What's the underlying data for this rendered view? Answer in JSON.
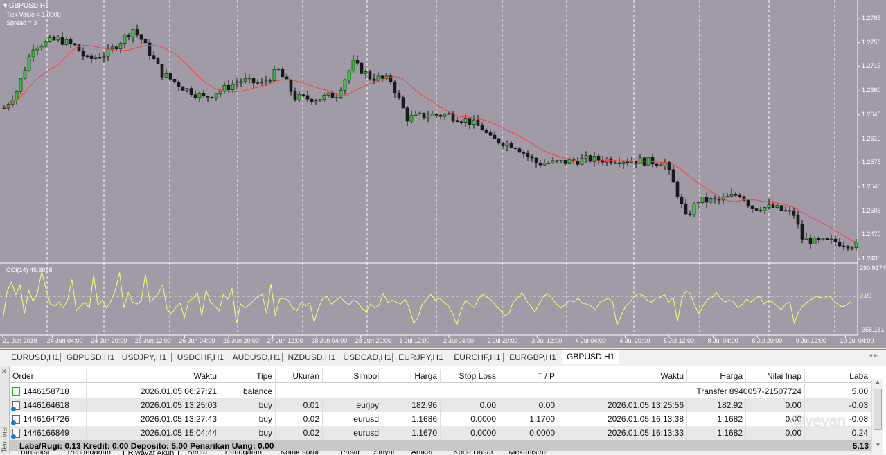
{
  "chart": {
    "symbol": "GBPUSD,H1",
    "tick_value": "Tick Value = 1.0000",
    "spread": "Spread = 3",
    "price_ticks": [
      "1.2785",
      "1.2750",
      "1.2715",
      "1.2680",
      "1.2645",
      "1.2610",
      "1.2575",
      "1.2540",
      "1.2505",
      "1.2470",
      "1.2435"
    ],
    "cci_label": "CCI(14) 45.6058",
    "cci_ticks": [
      "290.9174",
      "0.00",
      "-355.181"
    ],
    "time_ticks": [
      "21 Jun 2019",
      "24 Jun 04:00",
      "24 Jun 20:00",
      "25 Jun 12:00",
      "26 Jun 04:00",
      "26 Jun 20:00",
      "27 Jun 12:00",
      "28 Jun 04:00",
      "28 Jun 20:00",
      "1 Jul 12:00",
      "2 Jul 04:00",
      "2 Jul 20:00",
      "3 Jul 12:00",
      "4 Jul 04:00",
      "4 Jul 20:00",
      "5 Jul 12:00",
      "8 Jul 04:00",
      "8 Jul 20:00",
      "9 Jul 12:00",
      "10 Jul 04:00"
    ],
    "colors": {
      "bg": "#a09ba6",
      "ma": "#ff3b3b",
      "cci": "#ffff66",
      "bull": "#33cc33",
      "bear": "#1a1a1a"
    }
  },
  "chart_data": {
    "type": "candlestick",
    "title": "GBPUSD,H1",
    "ylim": [
      1.2435,
      1.2785
    ],
    "close_path": [
      [
        0,
        1.2655
      ],
      [
        3,
        1.268
      ],
      [
        7,
        1.2745
      ],
      [
        13,
        1.2755
      ],
      [
        17,
        1.2745
      ],
      [
        20,
        1.2725
      ],
      [
        25,
        1.2735
      ],
      [
        31,
        1.277
      ],
      [
        33,
        1.2755
      ],
      [
        38,
        1.2705
      ],
      [
        43,
        1.2685
      ],
      [
        48,
        1.267
      ],
      [
        52,
        1.268
      ],
      [
        57,
        1.2695
      ],
      [
        62,
        1.269
      ],
      [
        66,
        1.271
      ],
      [
        70,
        1.267
      ],
      [
        75,
        1.2668
      ],
      [
        80,
        1.2675
      ],
      [
        84,
        1.272
      ],
      [
        88,
        1.27
      ],
      [
        93,
        1.2695
      ],
      [
        97,
        1.264
      ],
      [
        102,
        1.2645
      ],
      [
        107,
        1.2645
      ],
      [
        112,
        1.2635
      ],
      [
        115,
        1.2625
      ],
      [
        117,
        1.261
      ],
      [
        123,
        1.26
      ],
      [
        128,
        1.2575
      ],
      [
        133,
        1.2575
      ],
      [
        140,
        1.258
      ],
      [
        147,
        1.258
      ],
      [
        153,
        1.2578
      ],
      [
        159,
        1.2575
      ],
      [
        162,
        1.253
      ],
      [
        164,
        1.2495
      ],
      [
        167,
        1.252
      ],
      [
        172,
        1.252
      ],
      [
        177,
        1.253
      ],
      [
        180,
        1.251
      ],
      [
        185,
        1.251
      ],
      [
        190,
        1.25
      ],
      [
        192,
        1.2465
      ],
      [
        195,
        1.246
      ],
      [
        200,
        1.246
      ],
      [
        205,
        1.2455
      ]
    ],
    "cci": {
      "name": "CCI(14)",
      "ylim": [
        -355.181,
        290.9174
      ],
      "values": [
        -250,
        50,
        150,
        20,
        120,
        -180,
        60,
        -50,
        30,
        260,
        80,
        -80,
        -100,
        -60,
        -120,
        -30,
        180,
        -150,
        -100,
        -60,
        -120,
        220,
        -90,
        -40,
        -120,
        -50,
        60,
        250,
        -120,
        40,
        -60,
        -80,
        -50,
        230,
        -60,
        -20,
        40,
        120,
        -140,
        -180,
        -120,
        -70,
        -220,
        -50,
        -20,
        40,
        -200,
        70,
        -60,
        -100,
        -150,
        20,
        -30,
        80,
        -280,
        -80,
        -120,
        -90,
        -40,
        0,
        20,
        -180,
        130,
        -200,
        -30,
        -20,
        -40,
        -120,
        -150,
        -60,
        -100,
        -70,
        -270,
        -120,
        -20,
        0,
        -80,
        -40,
        -10,
        -50,
        -90,
        -40,
        -60,
        -120,
        -160,
        -80,
        -120,
        -90,
        30,
        -60,
        -40,
        -60,
        -80,
        -30,
        -120,
        -280,
        -220,
        -80,
        -30,
        20,
        -40,
        -20,
        -60,
        -100,
        -180,
        -300,
        -140,
        -40,
        -80,
        -120,
        -20,
        20,
        -10,
        -40,
        -100,
        -140,
        -200,
        -180,
        -60,
        -20,
        40,
        -40,
        -100,
        -160,
        -80,
        0,
        30,
        -20,
        -80,
        -120,
        -90,
        -40,
        -60,
        -20,
        -70,
        -80,
        -100,
        -140,
        -60,
        -40,
        -20,
        -60,
        -300,
        -200,
        -100,
        -60,
        0,
        30,
        10,
        -40,
        -60,
        -20,
        -10,
        20,
        -60,
        -10,
        -260,
        -20,
        60,
        30,
        -100,
        -180,
        -90,
        -30,
        -10,
        40,
        -20,
        -60,
        -40,
        -60,
        -120,
        -80,
        -30,
        -60,
        -20,
        0,
        -80,
        -40,
        -60,
        -100,
        -140,
        -80,
        -60,
        -280,
        -160,
        -100,
        -60,
        -30,
        0,
        -10,
        -20,
        10,
        -40,
        -80,
        -110,
        -90,
        -60
      ]
    }
  },
  "symbol_tabs": [
    "EURUSD,H1",
    "GBPUSD,H1",
    "USDJPY,H1",
    "USDCHF,H1",
    "AUDUSD,H1",
    "NZDUSD,H1",
    "USDCAD,H1",
    "EURJPY,H1",
    "EURCHF,H1",
    "EURGBP,H1",
    "GBPUSD,H1"
  ],
  "active_tab": "GBPUSD,H1",
  "terminal": {
    "side_label": "Terminal",
    "columns": [
      "Order",
      "Waktu",
      "Tipe",
      "Ukuran",
      "Simbol",
      "Harga",
      "Stop Loss",
      "T / P",
      "Waktu",
      "Harga",
      "Nilai Inap",
      "Laba"
    ],
    "rows": [
      {
        "order": "1446158718",
        "time": "2026.01.05 06:27:21",
        "type": "balance",
        "comment": "Transfer 8940057-21507724",
        "profit": "5.00"
      },
      {
        "order": "1446164618",
        "time": "2026.01.05 13:25:03",
        "type": "buy",
        "size": "0.01",
        "symbol": "eurjpy",
        "price": "182.96",
        "sl": "0.00",
        "tp": "0.00",
        "close_time": "2026.01.05 13:25:56",
        "close_price": "182.92",
        "swap": "0.00",
        "profit": "-0.03"
      },
      {
        "order": "1446164726",
        "time": "2026.01.05 13:27:43",
        "type": "buy",
        "size": "0.02",
        "symbol": "eurusd",
        "price": "1.1686",
        "sl": "0.0000",
        "tp": "1.1700",
        "close_time": "2026.01.05 16:13:38",
        "close_price": "1.1682",
        "swap": "0.00",
        "profit": "-0.08"
      },
      {
        "order": "1446166849",
        "time": "2026.01.05 15:04:44",
        "type": "buy",
        "size": "0.02",
        "symbol": "eurusd",
        "price": "1.1670",
        "sl": "0.0000",
        "tp": "0.0000",
        "close_time": "2026.01.05 16:13:33",
        "close_price": "1.1682",
        "swap": "0.00",
        "profit": "0.24"
      }
    ],
    "summary": "Laba/Rugi: 0.13  Kredit: 0.00  Deposito: 5.00  Penarikan Uang: 0.00",
    "total": "5.13",
    "bottom_tabs": [
      "Transaksi",
      "Pendedahan",
      "Riwayat Akun",
      "Berita",
      "Peringatan",
      "Kotak surat",
      "Pasar",
      "Sinyal",
      "Artikel",
      "Kode Dasar",
      "Mekanisme"
    ],
    "watermark": "@yeyan"
  }
}
